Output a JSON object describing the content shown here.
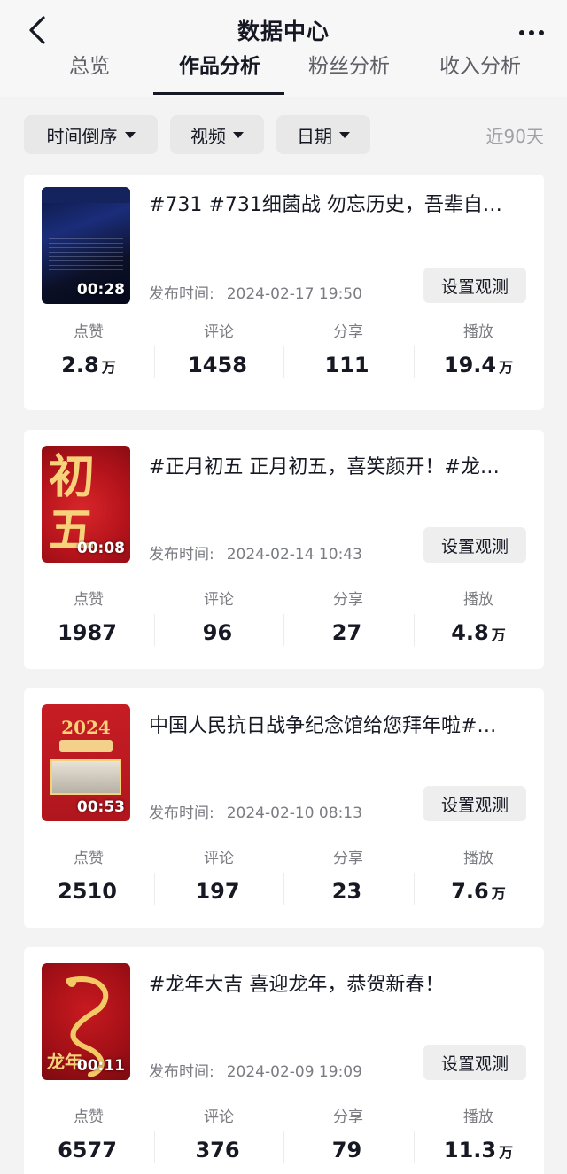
{
  "header": {
    "title": "数据中心",
    "tabs": [
      {
        "label": "总览",
        "active": false
      },
      {
        "label": "作品分析",
        "active": true
      },
      {
        "label": "粉丝分析",
        "active": false
      },
      {
        "label": "收入分析",
        "active": false
      }
    ]
  },
  "filters": {
    "sort": "时间倒序",
    "type": "视频",
    "date": "日期",
    "range": "近90天"
  },
  "labels": {
    "publish_time": "发布时间:",
    "observe_button": "设置观测",
    "likes": "点赞",
    "comments": "评论",
    "shares": "分享",
    "plays": "播放"
  },
  "videos": [
    {
      "title": "#731 #731细菌战 勿忘历史，吾辈自…",
      "duration": "00:28",
      "publish_time": "2024-02-17 19:50",
      "likes": "2.8",
      "likes_unit": "万",
      "comments": "1458",
      "comments_unit": "",
      "shares": "111",
      "shares_unit": "",
      "plays": "19.4",
      "plays_unit": "万"
    },
    {
      "title": "#正月初五 正月初五，喜笑颜开！#龙…",
      "duration": "00:08",
      "publish_time": "2024-02-14 10:43",
      "thumb_text": "初五",
      "likes": "1987",
      "likes_unit": "",
      "comments": "96",
      "comments_unit": "",
      "shares": "27",
      "shares_unit": "",
      "plays": "4.8",
      "plays_unit": "万"
    },
    {
      "title": "中国人民抗日战争纪念馆给您拜年啦#…",
      "duration": "00:53",
      "publish_time": "2024-02-10 08:13",
      "thumb_text": "2024",
      "likes": "2510",
      "likes_unit": "",
      "comments": "197",
      "comments_unit": "",
      "shares": "23",
      "shares_unit": "",
      "plays": "7.6",
      "plays_unit": "万"
    },
    {
      "title": "#龙年大吉 喜迎龙年，恭贺新春！",
      "duration": "00:11",
      "publish_time": "2024-02-09 19:09",
      "thumb_text": "龙年",
      "likes": "6577",
      "likes_unit": "",
      "comments": "376",
      "comments_unit": "",
      "shares": "79",
      "shares_unit": "",
      "plays": "11.3",
      "plays_unit": "万"
    }
  ]
}
